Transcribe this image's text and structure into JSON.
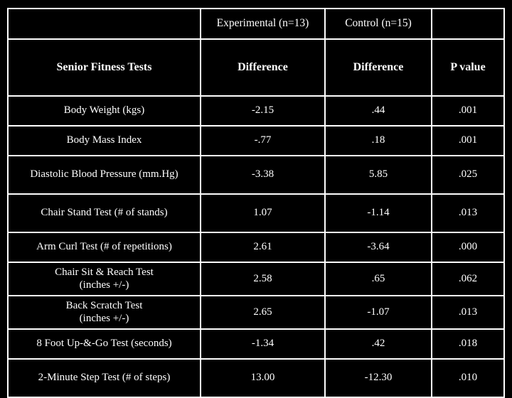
{
  "table": {
    "group_headers": {
      "row_label_blank": "",
      "experimental": "Experimental (n=13)",
      "control": "Control (n=15)",
      "p_blank": ""
    },
    "column_headers": {
      "row_label": "Senior Fitness Tests",
      "experimental": "Difference",
      "control": "Difference",
      "p_value": "P value"
    },
    "rows": [
      {
        "test": "Body Weight (kgs)",
        "test_line2": "",
        "experimental": "-2.15",
        "control": ".44",
        "p_value": ".001"
      },
      {
        "test": "Body Mass Index",
        "test_line2": "",
        "experimental": "-.77",
        "control": ".18",
        "p_value": ".001"
      },
      {
        "test": "Diastolic Blood Pressure (mm.Hg)",
        "test_line2": "",
        "experimental": "-3.38",
        "control": "5.85",
        "p_value": ".025"
      },
      {
        "test": "Chair Stand Test (# of stands)",
        "test_line2": "",
        "experimental": "1.07",
        "control": "-1.14",
        "p_value": ".013"
      },
      {
        "test": "Arm Curl Test (# of repetitions)",
        "test_line2": "",
        "experimental": "2.61",
        "control": "-3.64",
        "p_value": ".000"
      },
      {
        "test": "Chair Sit & Reach Test",
        "test_line2": "(inches +/-)",
        "experimental": "2.58",
        "control": ".65",
        "p_value": ".062"
      },
      {
        "test": "Back  Scratch Test",
        "test_line2": "(inches +/-)",
        "experimental": "2.65",
        "control": "-1.07",
        "p_value": ".013"
      },
      {
        "test": "8 Foot Up-&-Go Test (seconds)",
        "test_line2": "",
        "experimental": "-1.34",
        "control": ".42",
        "p_value": ".018"
      },
      {
        "test": "2-Minute Step Test (# of steps)",
        "test_line2": "",
        "experimental": "13.00",
        "control": "-12.30",
        "p_value": ".010"
      }
    ]
  },
  "colors": {
    "background": "#000000",
    "text": "#ffffff",
    "border": "#ffffff"
  }
}
